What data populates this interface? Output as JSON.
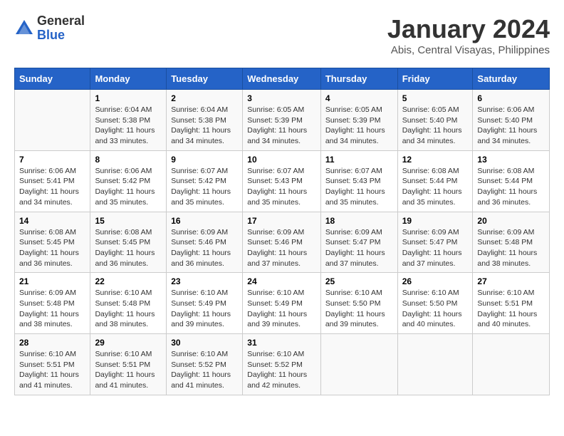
{
  "logo": {
    "general": "General",
    "blue": "Blue"
  },
  "title": "January 2024",
  "subtitle": "Abis, Central Visayas, Philippines",
  "weekdays": [
    "Sunday",
    "Monday",
    "Tuesday",
    "Wednesday",
    "Thursday",
    "Friday",
    "Saturday"
  ],
  "weeks": [
    [
      {
        "day": "",
        "sunrise": "",
        "sunset": "",
        "daylight": ""
      },
      {
        "day": "1",
        "sunrise": "Sunrise: 6:04 AM",
        "sunset": "Sunset: 5:38 PM",
        "daylight": "Daylight: 11 hours and 33 minutes."
      },
      {
        "day": "2",
        "sunrise": "Sunrise: 6:04 AM",
        "sunset": "Sunset: 5:38 PM",
        "daylight": "Daylight: 11 hours and 34 minutes."
      },
      {
        "day": "3",
        "sunrise": "Sunrise: 6:05 AM",
        "sunset": "Sunset: 5:39 PM",
        "daylight": "Daylight: 11 hours and 34 minutes."
      },
      {
        "day": "4",
        "sunrise": "Sunrise: 6:05 AM",
        "sunset": "Sunset: 5:39 PM",
        "daylight": "Daylight: 11 hours and 34 minutes."
      },
      {
        "day": "5",
        "sunrise": "Sunrise: 6:05 AM",
        "sunset": "Sunset: 5:40 PM",
        "daylight": "Daylight: 11 hours and 34 minutes."
      },
      {
        "day": "6",
        "sunrise": "Sunrise: 6:06 AM",
        "sunset": "Sunset: 5:40 PM",
        "daylight": "Daylight: 11 hours and 34 minutes."
      }
    ],
    [
      {
        "day": "7",
        "sunrise": "Sunrise: 6:06 AM",
        "sunset": "Sunset: 5:41 PM",
        "daylight": "Daylight: 11 hours and 34 minutes."
      },
      {
        "day": "8",
        "sunrise": "Sunrise: 6:06 AM",
        "sunset": "Sunset: 5:42 PM",
        "daylight": "Daylight: 11 hours and 35 minutes."
      },
      {
        "day": "9",
        "sunrise": "Sunrise: 6:07 AM",
        "sunset": "Sunset: 5:42 PM",
        "daylight": "Daylight: 11 hours and 35 minutes."
      },
      {
        "day": "10",
        "sunrise": "Sunrise: 6:07 AM",
        "sunset": "Sunset: 5:43 PM",
        "daylight": "Daylight: 11 hours and 35 minutes."
      },
      {
        "day": "11",
        "sunrise": "Sunrise: 6:07 AM",
        "sunset": "Sunset: 5:43 PM",
        "daylight": "Daylight: 11 hours and 35 minutes."
      },
      {
        "day": "12",
        "sunrise": "Sunrise: 6:08 AM",
        "sunset": "Sunset: 5:44 PM",
        "daylight": "Daylight: 11 hours and 35 minutes."
      },
      {
        "day": "13",
        "sunrise": "Sunrise: 6:08 AM",
        "sunset": "Sunset: 5:44 PM",
        "daylight": "Daylight: 11 hours and 36 minutes."
      }
    ],
    [
      {
        "day": "14",
        "sunrise": "Sunrise: 6:08 AM",
        "sunset": "Sunset: 5:45 PM",
        "daylight": "Daylight: 11 hours and 36 minutes."
      },
      {
        "day": "15",
        "sunrise": "Sunrise: 6:08 AM",
        "sunset": "Sunset: 5:45 PM",
        "daylight": "Daylight: 11 hours and 36 minutes."
      },
      {
        "day": "16",
        "sunrise": "Sunrise: 6:09 AM",
        "sunset": "Sunset: 5:46 PM",
        "daylight": "Daylight: 11 hours and 36 minutes."
      },
      {
        "day": "17",
        "sunrise": "Sunrise: 6:09 AM",
        "sunset": "Sunset: 5:46 PM",
        "daylight": "Daylight: 11 hours and 37 minutes."
      },
      {
        "day": "18",
        "sunrise": "Sunrise: 6:09 AM",
        "sunset": "Sunset: 5:47 PM",
        "daylight": "Daylight: 11 hours and 37 minutes."
      },
      {
        "day": "19",
        "sunrise": "Sunrise: 6:09 AM",
        "sunset": "Sunset: 5:47 PM",
        "daylight": "Daylight: 11 hours and 37 minutes."
      },
      {
        "day": "20",
        "sunrise": "Sunrise: 6:09 AM",
        "sunset": "Sunset: 5:48 PM",
        "daylight": "Daylight: 11 hours and 38 minutes."
      }
    ],
    [
      {
        "day": "21",
        "sunrise": "Sunrise: 6:09 AM",
        "sunset": "Sunset: 5:48 PM",
        "daylight": "Daylight: 11 hours and 38 minutes."
      },
      {
        "day": "22",
        "sunrise": "Sunrise: 6:10 AM",
        "sunset": "Sunset: 5:48 PM",
        "daylight": "Daylight: 11 hours and 38 minutes."
      },
      {
        "day": "23",
        "sunrise": "Sunrise: 6:10 AM",
        "sunset": "Sunset: 5:49 PM",
        "daylight": "Daylight: 11 hours and 39 minutes."
      },
      {
        "day": "24",
        "sunrise": "Sunrise: 6:10 AM",
        "sunset": "Sunset: 5:49 PM",
        "daylight": "Daylight: 11 hours and 39 minutes."
      },
      {
        "day": "25",
        "sunrise": "Sunrise: 6:10 AM",
        "sunset": "Sunset: 5:50 PM",
        "daylight": "Daylight: 11 hours and 39 minutes."
      },
      {
        "day": "26",
        "sunrise": "Sunrise: 6:10 AM",
        "sunset": "Sunset: 5:50 PM",
        "daylight": "Daylight: 11 hours and 40 minutes."
      },
      {
        "day": "27",
        "sunrise": "Sunrise: 6:10 AM",
        "sunset": "Sunset: 5:51 PM",
        "daylight": "Daylight: 11 hours and 40 minutes."
      }
    ],
    [
      {
        "day": "28",
        "sunrise": "Sunrise: 6:10 AM",
        "sunset": "Sunset: 5:51 PM",
        "daylight": "Daylight: 11 hours and 41 minutes."
      },
      {
        "day": "29",
        "sunrise": "Sunrise: 6:10 AM",
        "sunset": "Sunset: 5:51 PM",
        "daylight": "Daylight: 11 hours and 41 minutes."
      },
      {
        "day": "30",
        "sunrise": "Sunrise: 6:10 AM",
        "sunset": "Sunset: 5:52 PM",
        "daylight": "Daylight: 11 hours and 41 minutes."
      },
      {
        "day": "31",
        "sunrise": "Sunrise: 6:10 AM",
        "sunset": "Sunset: 5:52 PM",
        "daylight": "Daylight: 11 hours and 42 minutes."
      },
      {
        "day": "",
        "sunrise": "",
        "sunset": "",
        "daylight": ""
      },
      {
        "day": "",
        "sunrise": "",
        "sunset": "",
        "daylight": ""
      },
      {
        "day": "",
        "sunrise": "",
        "sunset": "",
        "daylight": ""
      }
    ]
  ]
}
